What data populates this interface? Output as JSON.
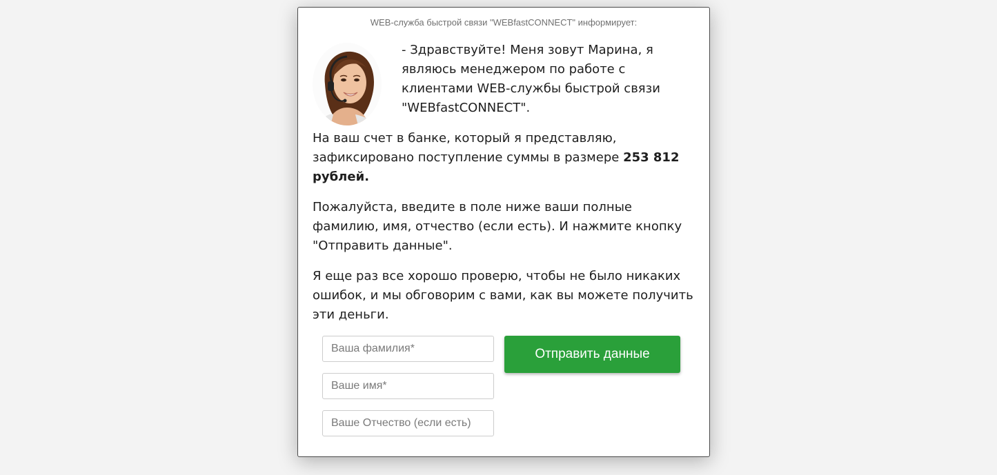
{
  "header": {
    "title": "WEB-служба быстрой связи \"WEBfastCONNECT\" информирует:"
  },
  "avatar": {
    "icon": "operator-headset-avatar"
  },
  "intro": {
    "text": "- Здравствуйте! Меня зовут Марина, я являюсь менеджером по работе с клиентами WEB-службы быстрой связи \"WEBfastCONNECT\"."
  },
  "body": {
    "p1_text": "На ваш счет в банке, который я представляю, зафиксировано поступление суммы в размере",
    "p1_amount": "253 812 рублей.",
    "p2": "Пожалуйста, введите в поле ниже ваши полные фамилию, имя, отчество (если есть). И нажмите кнопку \"Отправить данные\".",
    "p3": "Я еще раз все хорошо проверю, чтобы не было никаких ошибок, и мы обговорим с вами, как вы можете получить эти деньги."
  },
  "form": {
    "surname_placeholder": "Ваша фамилия*",
    "name_placeholder": "Ваше имя*",
    "patronymic_placeholder": "Ваше Отчество (если есть)",
    "submit_label": "Отправить данные"
  },
  "colors": {
    "accent": "#2aa03a",
    "page_background": "#f3f3f3"
  }
}
